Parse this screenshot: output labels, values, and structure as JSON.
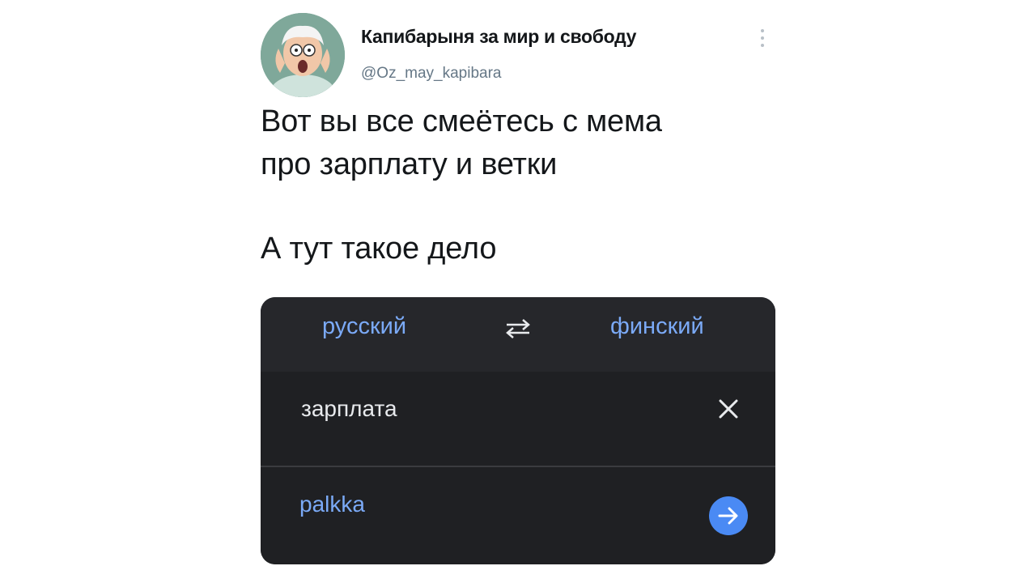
{
  "tweet": {
    "display_name": "Капибарыня за мир и свободу",
    "handle": "@Oz_may_kapibara",
    "text_lines": [
      "Вот вы все смеётесь с мема",
      "про зарплату и ветки",
      "А тут такое дело"
    ],
    "icons": {
      "avatar": "cartoon-old-man-avatar",
      "more": "more-vertical-icon"
    }
  },
  "translator": {
    "source_language": "русский",
    "target_language": "финский",
    "input_text": "зарплата",
    "output_text": "palkka",
    "icons": {
      "swap": "swap-languages-icon",
      "clear": "close-icon",
      "go": "arrow-right-icon"
    },
    "colors": {
      "panel": "#1f2023",
      "header": "#26272b",
      "accent": "#7baaf7",
      "button": "#4a8af4"
    }
  }
}
